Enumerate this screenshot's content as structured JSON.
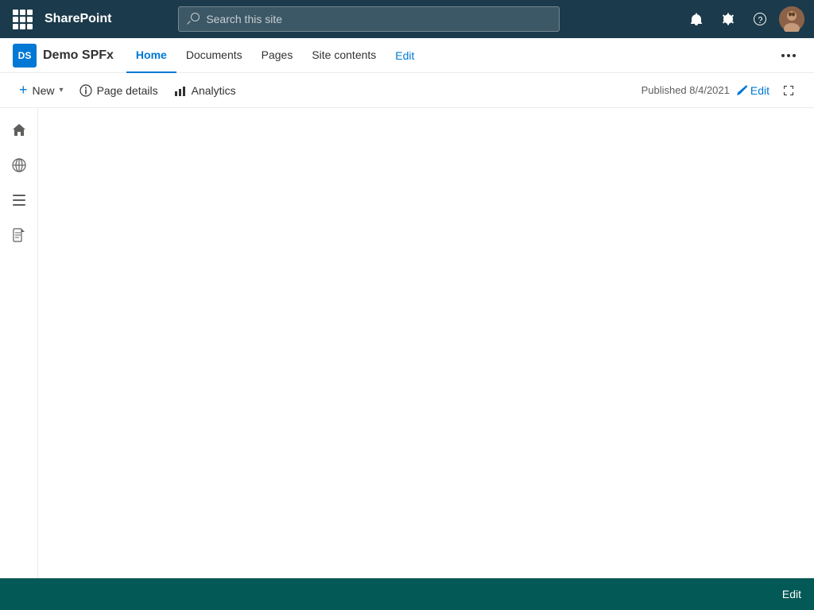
{
  "topbar": {
    "app_name": "SharePoint",
    "search_placeholder": "Search this site"
  },
  "site_nav": {
    "logo_text": "DS",
    "site_name": "Demo SPFx",
    "tabs": [
      {
        "label": "Home",
        "active": true
      },
      {
        "label": "Documents",
        "active": false
      },
      {
        "label": "Pages",
        "active": false
      },
      {
        "label": "Site contents",
        "active": false
      }
    ],
    "edit_label": "Edit",
    "more_label": "..."
  },
  "toolbar": {
    "new_label": "New",
    "page_details_label": "Page details",
    "analytics_label": "Analytics",
    "published_label": "Published 8/4/2021",
    "edit_label": "Edit"
  },
  "sidebar": {
    "icons": [
      {
        "name": "home-icon",
        "symbol": "⌂"
      },
      {
        "name": "globe-icon",
        "symbol": "🌐"
      },
      {
        "name": "list-icon",
        "symbol": "☰"
      },
      {
        "name": "note-icon",
        "symbol": "📄"
      }
    ]
  },
  "bottom_bar": {
    "edit_label": "Edit"
  },
  "colors": {
    "topbar_bg": "#1b3a4b",
    "accent": "#0078d4",
    "bottom_bar_bg": "#025955"
  }
}
